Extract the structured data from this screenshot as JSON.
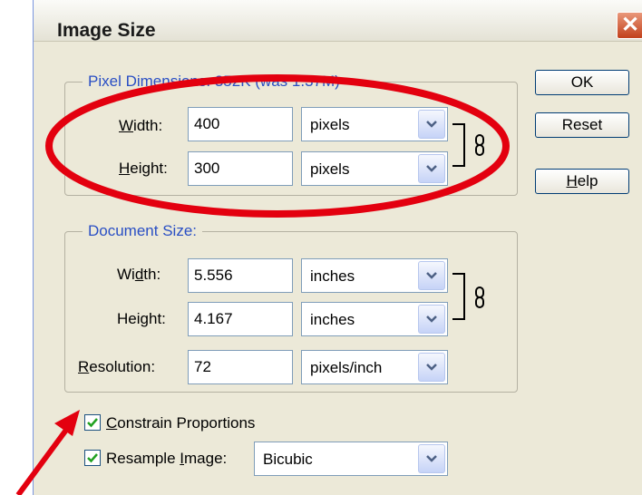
{
  "window": {
    "title": "Image Size",
    "close_icon": "✕"
  },
  "pixel_dimensions": {
    "legend_prefix": "Pixel Dimensions:",
    "legend_value": "352K (was 1.37M)",
    "width_label": "Width:",
    "width_value": "400",
    "width_unit": "pixels",
    "height_label": "Height:",
    "height_value": "300",
    "height_unit": "pixels"
  },
  "document_size": {
    "legend": "Document Size:",
    "width_label": "Width:",
    "width_value": "5.556",
    "width_unit": "inches",
    "height_label": "Height:",
    "height_value": "4.167",
    "height_unit": "inches",
    "resolution_label": "Resolution:",
    "resolution_value": "72",
    "resolution_unit": "pixels/inch"
  },
  "options": {
    "constrain_label": "Constrain Proportions",
    "constrain_checked": true,
    "resample_label": "Resample Image:",
    "resample_checked": true,
    "resample_method": "Bicubic"
  },
  "buttons": {
    "ok": "OK",
    "reset": "Reset",
    "help": "Help"
  },
  "annotations": {
    "ellipse_color": "#e3000f",
    "arrow_color": "#e3000f"
  },
  "icons": [
    "close-icon",
    "chevron-down-icon",
    "chain-link-icon",
    "checkmark-icon"
  ]
}
